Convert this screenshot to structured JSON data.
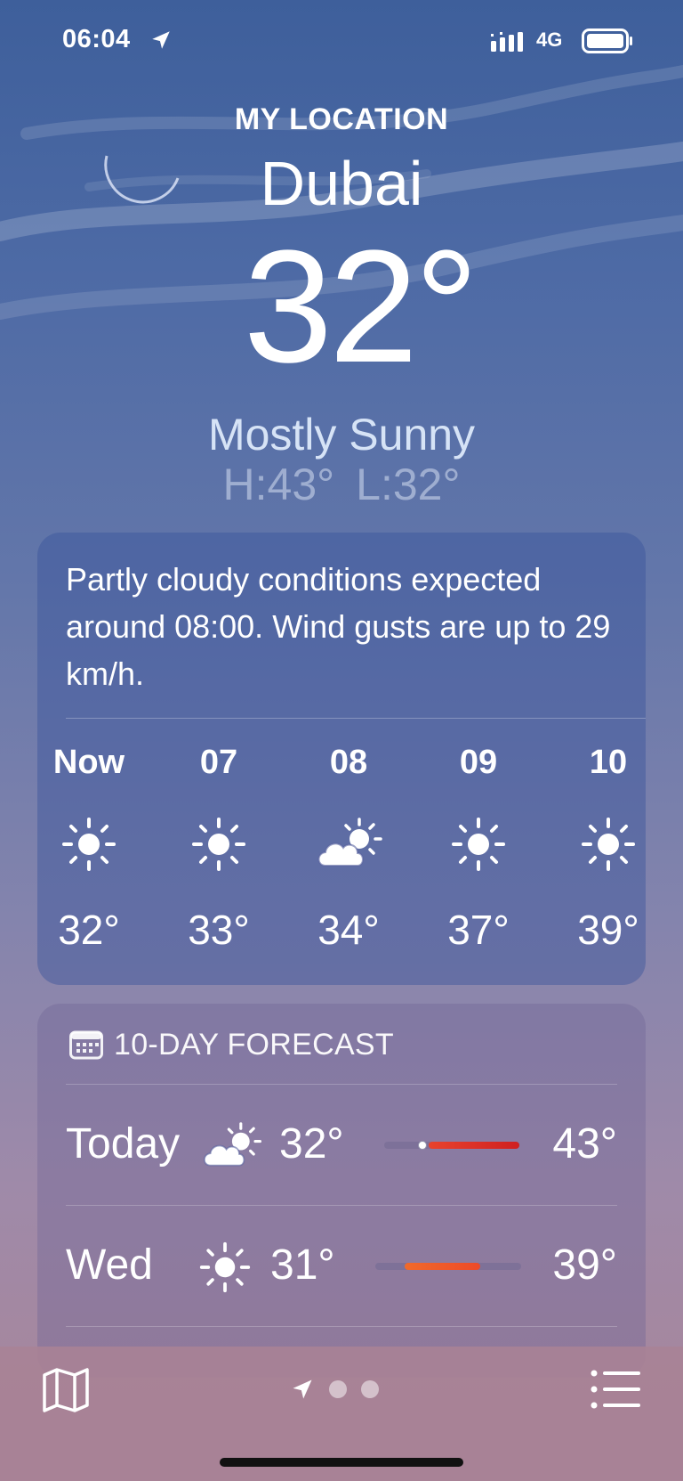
{
  "status_bar": {
    "time": "06:04",
    "network": "4G",
    "icons": [
      "location-arrow-icon",
      "signal-icon",
      "battery-icon"
    ]
  },
  "header": {
    "location_label": "MY LOCATION",
    "city": "Dubai",
    "temperature": "32°",
    "condition": "Mostly Sunny",
    "high": "H:43°",
    "low": "L:32°"
  },
  "hourly": {
    "summary": "Partly cloudy conditions expected around 08:00. Wind gusts are up to 29 km/h.",
    "items": [
      {
        "time": "Now",
        "icon": "sun-icon",
        "temp": "32°"
      },
      {
        "time": "07",
        "icon": "sun-icon",
        "temp": "33°"
      },
      {
        "time": "08",
        "icon": "partly-cloudy-icon",
        "temp": "34°"
      },
      {
        "time": "09",
        "icon": "sun-icon",
        "temp": "37°"
      },
      {
        "time": "10",
        "icon": "sun-icon",
        "temp": "39°"
      }
    ]
  },
  "forecast": {
    "title": "10-DAY FORECAST",
    "header_icon": "calendar-icon",
    "days": [
      {
        "day": "Today",
        "icon": "partly-cloudy-icon",
        "low": "32°",
        "high": "43°",
        "range_start": 0.33,
        "range_end": 1.0,
        "current": 0.28,
        "color_start": "#e8432d",
        "color_end": "#cf2020"
      },
      {
        "day": "Wed",
        "icon": "sun-icon",
        "low": "31°",
        "high": "39°",
        "range_start": 0.2,
        "range_end": 0.72,
        "color_start": "#f06a2a",
        "color_end": "#ee4a28"
      }
    ]
  },
  "toolbar": {
    "icons": [
      "map-icon",
      "location-arrow-icon",
      "list-icon"
    ],
    "page_count": 3,
    "current_page": 0
  },
  "colors": {
    "condition_text": "#d6e3f6",
    "card_hourly": "rgba(58,85,155,0.45)",
    "card_forecast": "rgba(110,100,150,0.38)"
  }
}
